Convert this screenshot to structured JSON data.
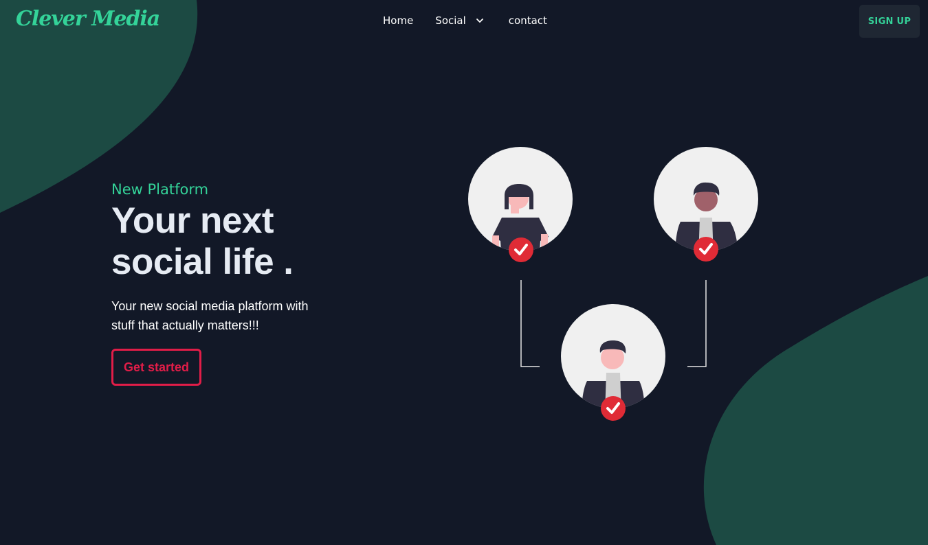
{
  "header": {
    "logo": "Clever Media",
    "nav": {
      "home": "Home",
      "social": "Social",
      "contact": "contact"
    },
    "signup_label": "SIGN UP"
  },
  "hero": {
    "eyebrow": "New Platform",
    "headline_line1": "Your next",
    "headline_line2": "social life .",
    "subtext": "Your new social media platform with stuff that actually matters!!!",
    "cta_label": "Get started"
  },
  "colors": {
    "background": "#121827",
    "accent": "#34d399",
    "blob": "#1c4a43",
    "cta": "#e11d48",
    "badge": "#e02b36",
    "avatar_bg": "#f0f0f0",
    "button_bg": "#1f2733"
  },
  "icons": {
    "nav_social": "chevron-down-icon",
    "badges": "check-circle-icon"
  }
}
